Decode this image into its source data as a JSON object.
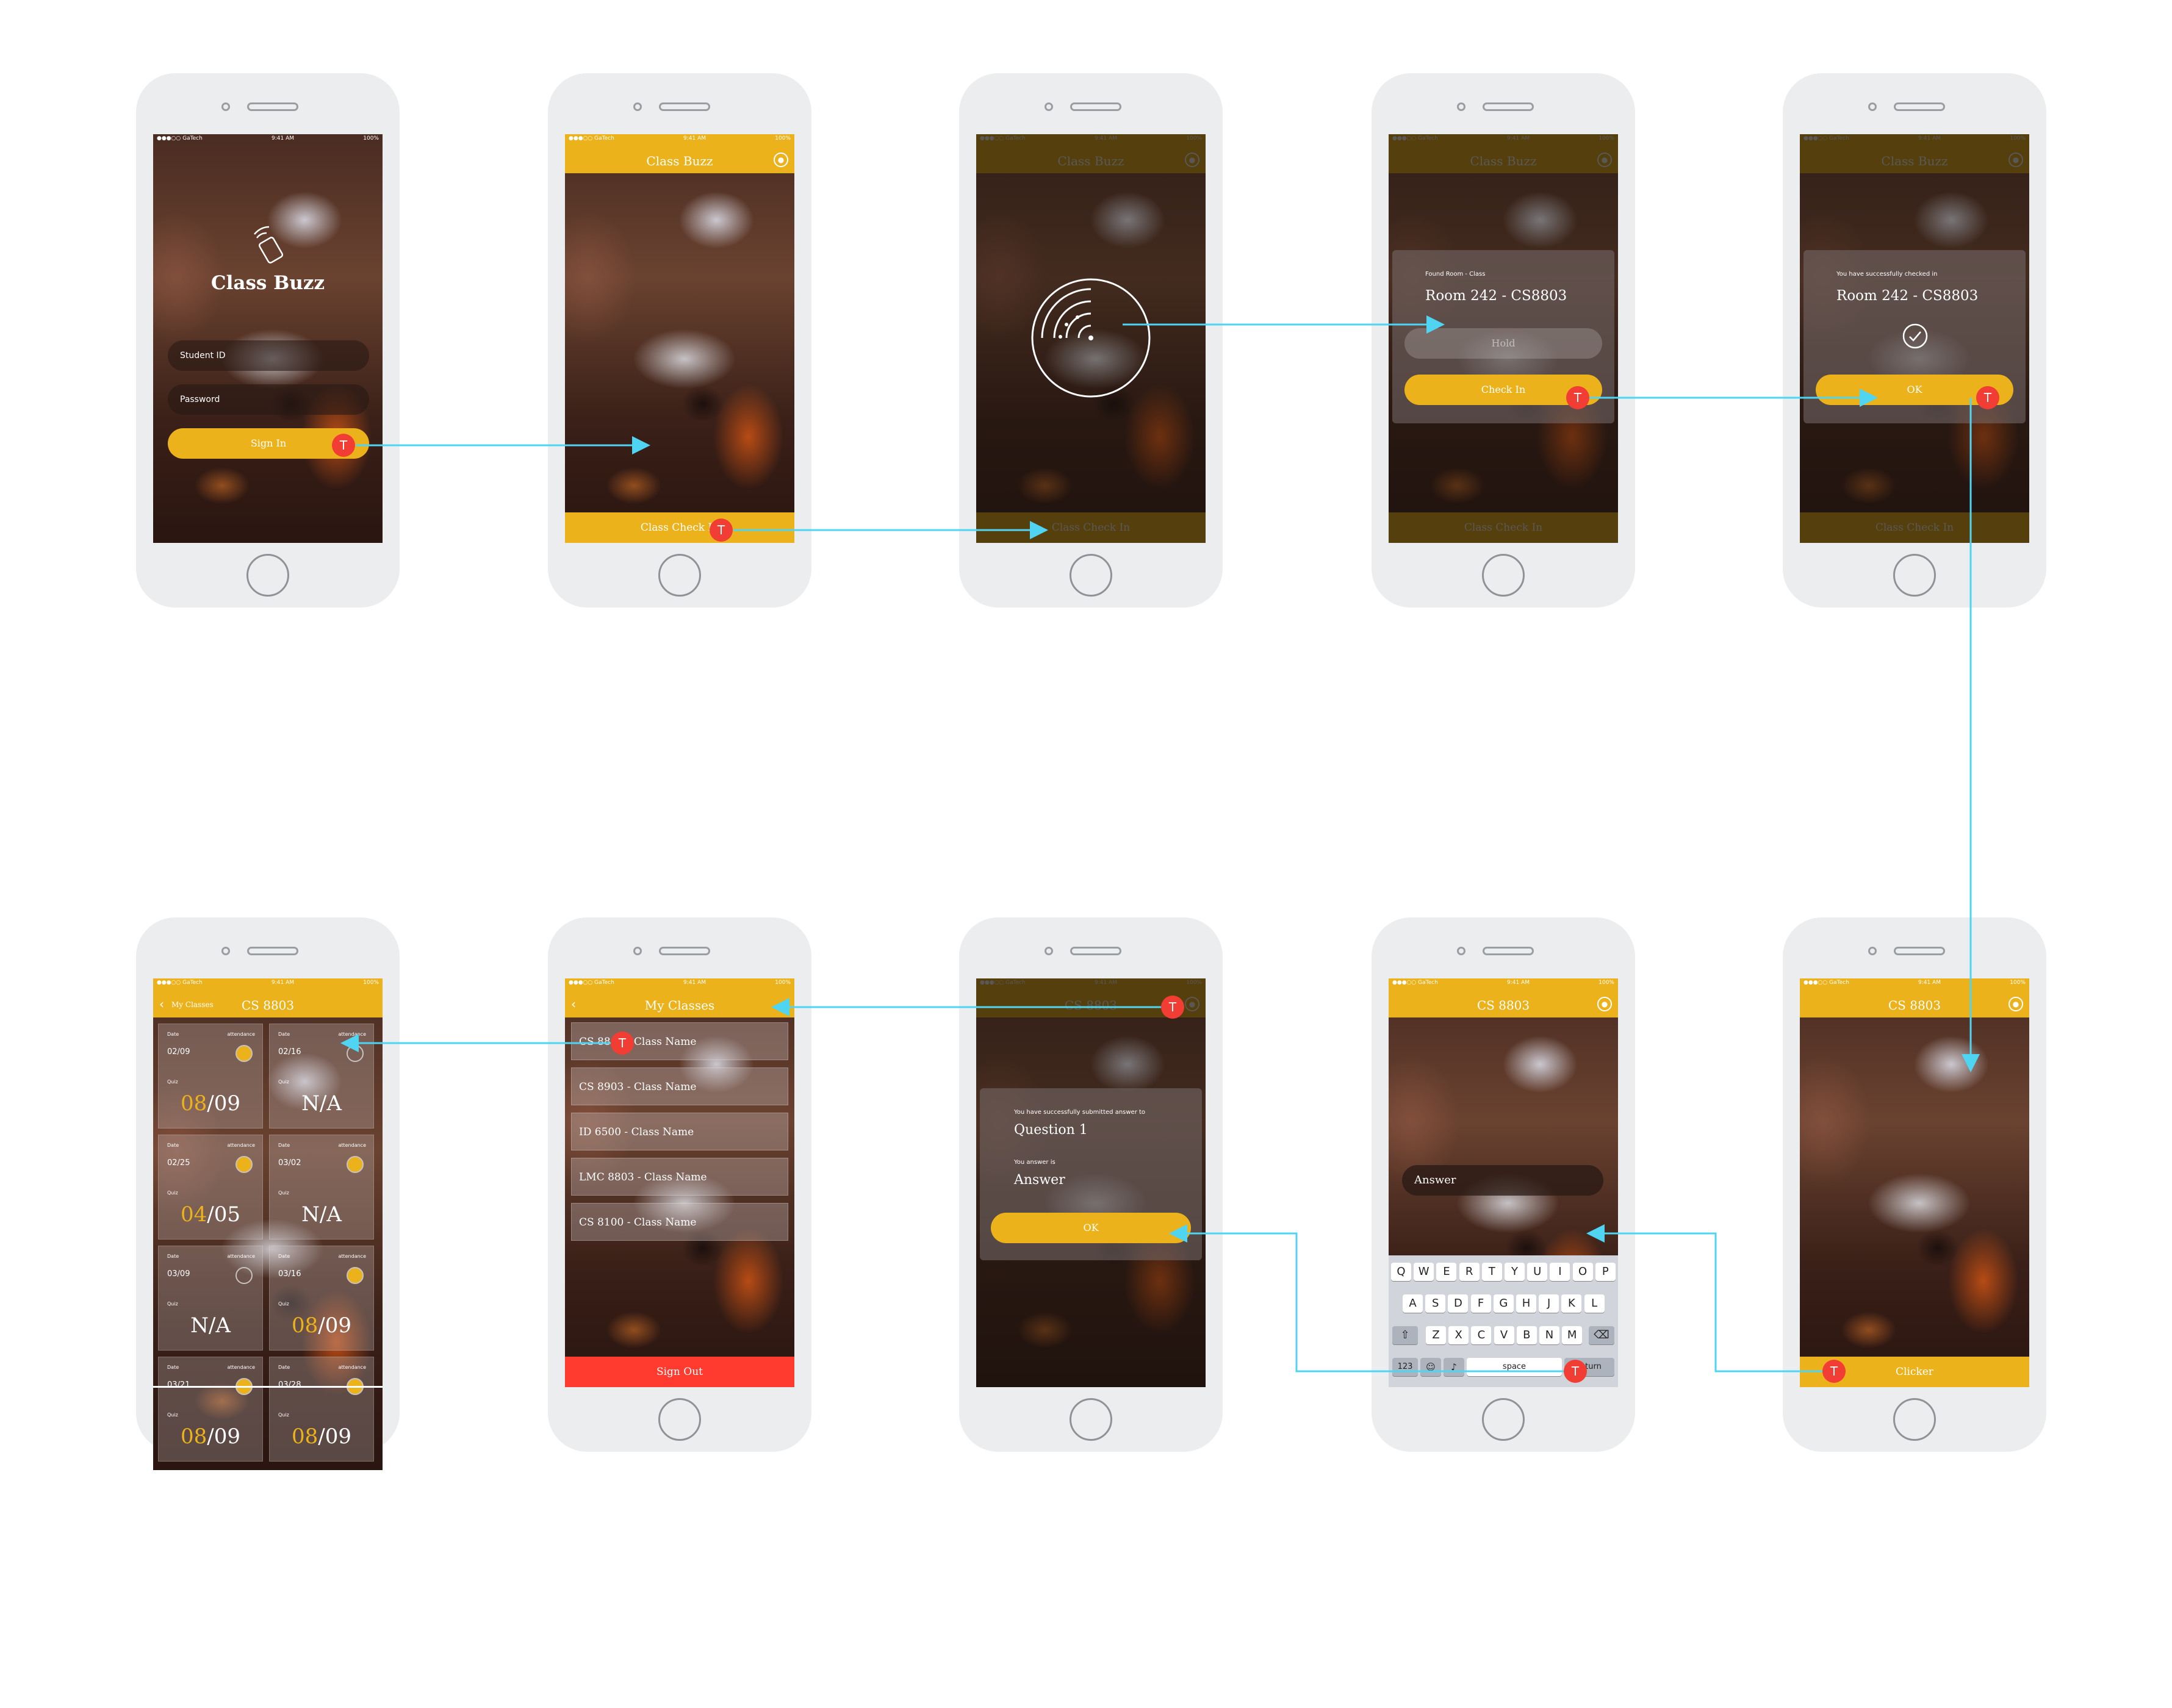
{
  "status": {
    "carrier": "●●●○○ GaTech",
    "time": "9:41 AM",
    "battery": "100%"
  },
  "app_name": "Class Buzz",
  "marker_label": "T",
  "s1": {
    "student_id_placeholder": "Student ID",
    "password_placeholder": "Password",
    "sign_in": "Sign In"
  },
  "s2": {
    "title": "Class Buzz",
    "bottom": "Class Check In"
  },
  "s3": {
    "title": "Class Buzz",
    "bottom": "Class Check In"
  },
  "s4": {
    "title": "Class Buzz",
    "caption": "Found Room - Class",
    "room": "Room 242 - CS8803",
    "hold": "Hold",
    "check_in": "Check In",
    "bottom": "Class Check In"
  },
  "s5": {
    "title": "Class Buzz",
    "caption": "You have successfully checked in",
    "room": "Room 242 - CS8803",
    "ok": "OK",
    "bottom": "Class Check In"
  },
  "s6": {
    "title": "CS 8803",
    "bottom": "Clicker"
  },
  "s7": {
    "title": "CS 8803",
    "answer_placeholder": "Answer",
    "keys_row1": [
      "Q",
      "W",
      "E",
      "R",
      "T",
      "Y",
      "U",
      "I",
      "O",
      "P"
    ],
    "keys_row2": [
      "A",
      "S",
      "D",
      "F",
      "G",
      "H",
      "J",
      "K",
      "L"
    ],
    "keys_row3": [
      "Z",
      "X",
      "C",
      "V",
      "B",
      "N",
      "M"
    ],
    "key_123": "123",
    "key_space": "space",
    "key_return": "return"
  },
  "s8": {
    "title": "CS 8803",
    "caption1": "You have successfully submitted answer to",
    "question": "Question 1",
    "caption2": "You answer is",
    "answer": "Answer",
    "ok": "OK"
  },
  "s9": {
    "title": "My Classes",
    "classes": [
      "CS 8803 - Class Name",
      "CS 8903 - Class Name",
      "ID 6500 - Class Name",
      "LMC 8803 - Class Name",
      "CS 8100 - Class Name"
    ],
    "sign_out": "Sign Out"
  },
  "s10": {
    "title": "CS 8803",
    "back_label": "My Classes",
    "date_label": "Date",
    "attendance_label": "attendance",
    "quiz_label": "Quiz",
    "tiles": [
      {
        "date": "02/09",
        "attended": true,
        "score_hl": "08",
        "score_rest": "/09"
      },
      {
        "date": "02/16",
        "attended": false,
        "score_hl": "",
        "score_rest": "N/A"
      },
      {
        "date": "02/25",
        "attended": true,
        "score_hl": "04",
        "score_rest": "/05"
      },
      {
        "date": "03/02",
        "attended": true,
        "score_hl": "",
        "score_rest": "N/A"
      },
      {
        "date": "03/09",
        "attended": false,
        "score_hl": "",
        "score_rest": "N/A"
      },
      {
        "date": "03/16",
        "attended": true,
        "score_hl": "08",
        "score_rest": "/09"
      },
      {
        "date": "03/21",
        "attended": true,
        "score_hl": "08",
        "score_rest": "/09"
      },
      {
        "date": "03/28",
        "attended": true,
        "score_hl": "08",
        "score_rest": "/09"
      }
    ]
  },
  "colors": {
    "accent": "#ecb21b",
    "marker": "#f23d34",
    "flow": "#4fd4f2",
    "danger": "#ff3b30"
  }
}
